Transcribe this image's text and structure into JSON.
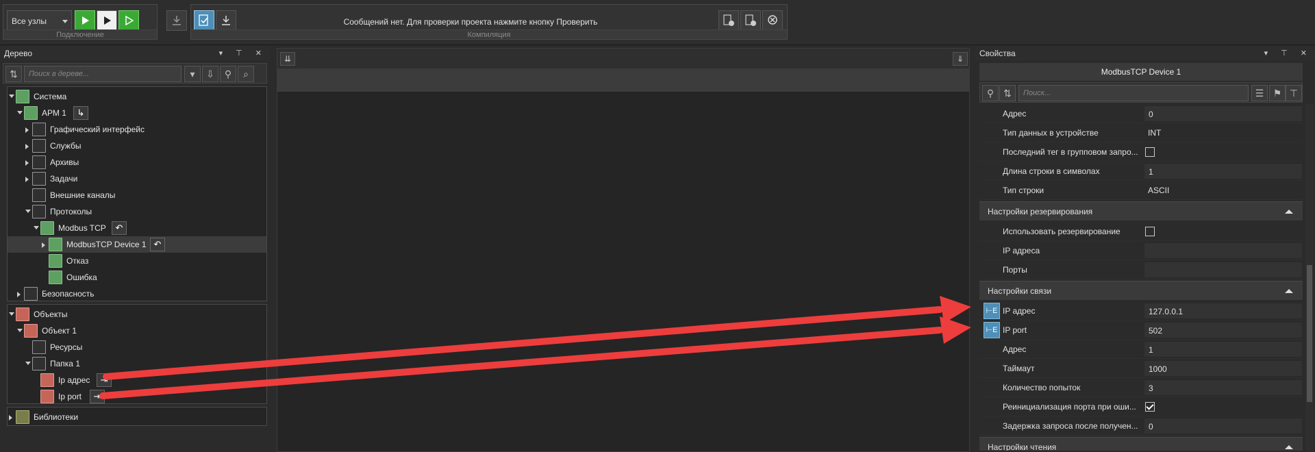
{
  "toolbar": {
    "node_select": "Все узлы",
    "status_message": "Сообщений нет. Для проверки проекта нажмите кнопку Проверить",
    "connect_caption": "Подключение",
    "compile_caption": "Компиляция"
  },
  "tree_panel": {
    "title": "Дерево",
    "search_placeholder": "Поиск в дереве...",
    "items": [
      {
        "label": "Система"
      },
      {
        "label": "АРМ 1"
      },
      {
        "label": "Графический интерфейс"
      },
      {
        "label": "Службы"
      },
      {
        "label": "Архивы"
      },
      {
        "label": "Задачи"
      },
      {
        "label": "Внешние каналы"
      },
      {
        "label": "Протоколы"
      },
      {
        "label": "Modbus TCP"
      },
      {
        "label": "ModbusTCP Device 1"
      },
      {
        "label": "Отказ"
      },
      {
        "label": "Ошибка"
      },
      {
        "label": "Безопасность"
      },
      {
        "label": "Объекты"
      },
      {
        "label": "Объект 1"
      },
      {
        "label": "Ресурсы"
      },
      {
        "label": "Папка 1"
      },
      {
        "label": "Ip адрес"
      },
      {
        "label": "Ip port"
      },
      {
        "label": "Библиотеки"
      }
    ]
  },
  "properties_panel": {
    "title": "Свойства",
    "object_name": "ModbusTCP Device 1",
    "search_placeholder": "Поиск...",
    "rows": [
      {
        "name": "Адрес",
        "value": "0"
      },
      {
        "name": "Тип данных в устройстве",
        "value": "INT"
      },
      {
        "name": "Последний тег в групповом запро...",
        "value": ""
      },
      {
        "name": "Длина строки в символах",
        "value": "1"
      },
      {
        "name": "Тип строки",
        "value": "ASCII"
      }
    ],
    "section_reserve": "Настройки резервирования",
    "reserve_rows": [
      {
        "name": "Использовать резервирование",
        "value": ""
      },
      {
        "name": "IP адреса",
        "value": ""
      },
      {
        "name": "Порты",
        "value": ""
      }
    ],
    "section_link": "Настройки связи",
    "link_rows": [
      {
        "name": "IP адрес",
        "value": "127.0.0.1"
      },
      {
        "name": "IP port",
        "value": "502"
      },
      {
        "name": "Адрес",
        "value": "1"
      },
      {
        "name": "Таймаут",
        "value": "1000"
      },
      {
        "name": "Количество попыток",
        "value": "3"
      },
      {
        "name": "Реинициализация порта при оши...",
        "value": ""
      },
      {
        "name": "Задержка запроса после получен...",
        "value": "0"
      }
    ],
    "section_read": "Настройки чтения"
  },
  "colors": {
    "accent_green": "#3aaa35",
    "arrow_red": "#ee3d3d",
    "bind_blue": "#4d8fb8"
  }
}
